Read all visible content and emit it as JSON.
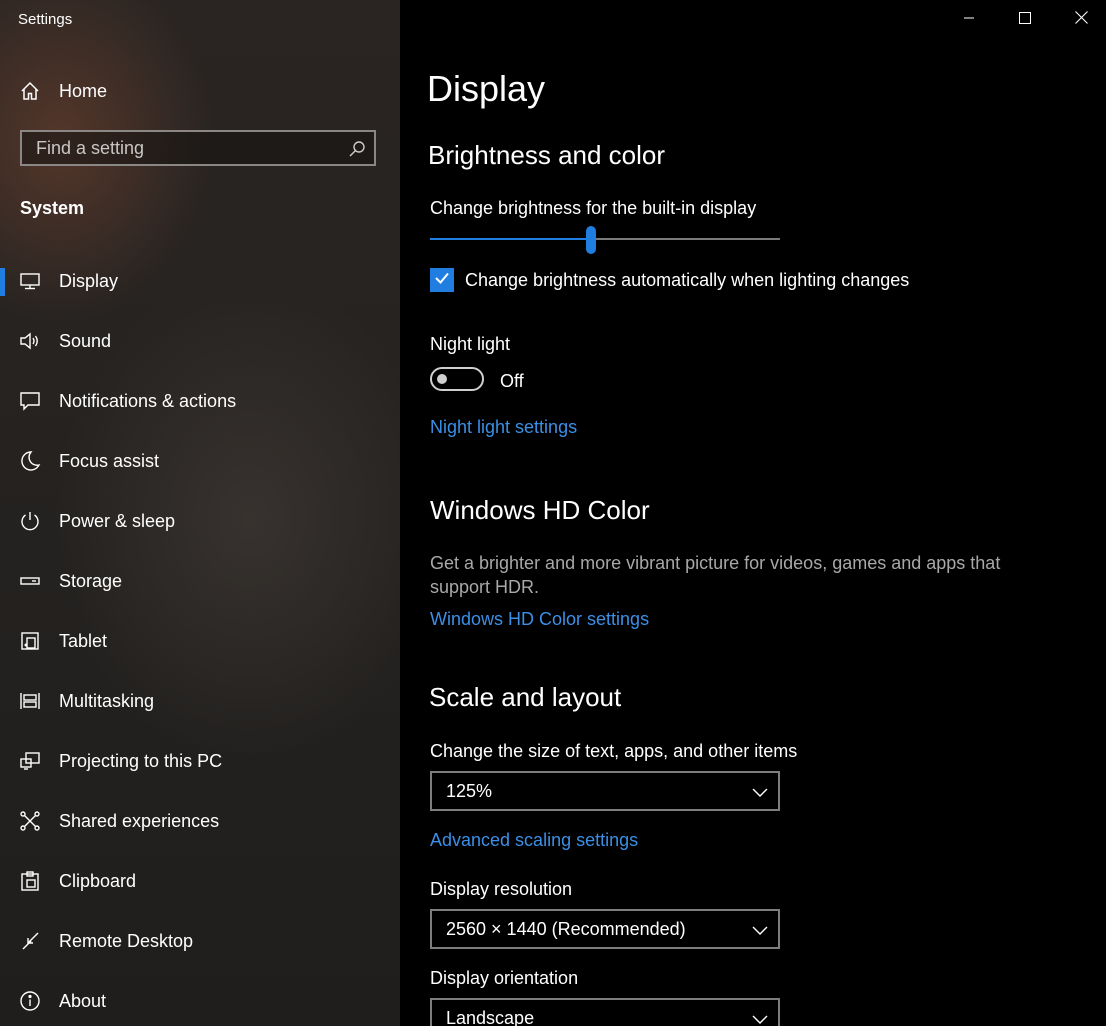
{
  "window": {
    "title": "Settings",
    "minimize_icon": "minimize-icon",
    "maximize_icon": "maximize-icon",
    "close_icon": "close-icon"
  },
  "sidebar": {
    "home_label": "Home",
    "search_placeholder": "Find a setting",
    "section": "System",
    "accent_color": "#1f7ee0",
    "items": [
      {
        "label": "Display",
        "icon": "monitor-icon",
        "active": true
      },
      {
        "label": "Sound",
        "icon": "speaker-icon"
      },
      {
        "label": "Notifications & actions",
        "icon": "notification-icon"
      },
      {
        "label": "Focus assist",
        "icon": "moon-icon"
      },
      {
        "label": "Power & sleep",
        "icon": "power-icon"
      },
      {
        "label": "Storage",
        "icon": "storage-icon"
      },
      {
        "label": "Tablet",
        "icon": "tablet-icon"
      },
      {
        "label": "Multitasking",
        "icon": "multitasking-icon"
      },
      {
        "label": "Projecting to this PC",
        "icon": "projecting-icon"
      },
      {
        "label": "Shared experiences",
        "icon": "shared-icon"
      },
      {
        "label": "Clipboard",
        "icon": "clipboard-icon"
      },
      {
        "label": "Remote Desktop",
        "icon": "remote-icon"
      },
      {
        "label": "About",
        "icon": "info-icon"
      }
    ]
  },
  "main": {
    "title": "Display",
    "brightness": {
      "heading": "Brightness and color",
      "slider_label": "Change brightness for the built-in display",
      "slider_value": 0.46,
      "auto_checkbox_label": "Change brightness automatically when lighting changes",
      "auto_checked": true
    },
    "night_light": {
      "label": "Night light",
      "state": "Off",
      "settings_link": "Night light settings"
    },
    "hd_color": {
      "heading": "Windows HD Color",
      "description": "Get a brighter and more vibrant picture for videos, games and apps that support HDR.",
      "settings_link": "Windows HD Color settings"
    },
    "scale": {
      "heading": "Scale and layout",
      "size_label": "Change the size of text, apps, and other items",
      "size_value": "125%",
      "advanced_link": "Advanced scaling settings",
      "resolution_label": "Display resolution",
      "resolution_value": "2560 × 1440 (Recommended)",
      "orientation_label": "Display orientation",
      "orientation_value": "Landscape"
    },
    "link_color": "#3b8fe6"
  }
}
